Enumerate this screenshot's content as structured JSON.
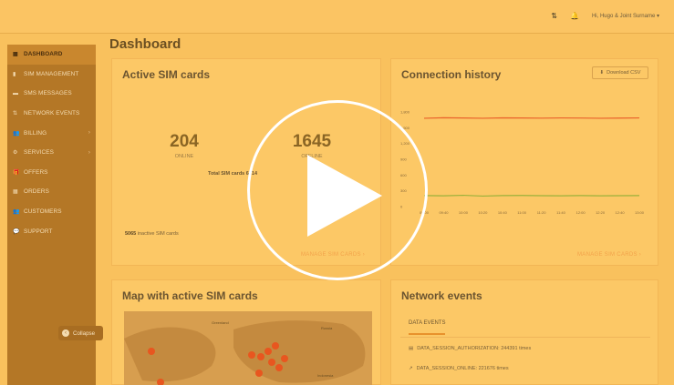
{
  "topbar": {
    "user_label": "Hi, Hugo & Joint Surname"
  },
  "sidebar": {
    "items": [
      {
        "label": "Dashboard",
        "icon": "grid-icon",
        "active": true
      },
      {
        "label": "SIM Management",
        "icon": "sim-icon"
      },
      {
        "label": "SMS Messages",
        "icon": "message-icon"
      },
      {
        "label": "Network Events",
        "icon": "signal-icon"
      },
      {
        "label": "Billing",
        "icon": "people-icon",
        "has_submenu": true
      },
      {
        "label": "Services",
        "icon": "gear-icon",
        "has_submenu": true
      },
      {
        "label": "Offers",
        "icon": "gift-icon"
      },
      {
        "label": "Orders",
        "icon": "box-icon"
      },
      {
        "label": "Customers",
        "icon": "people-icon"
      },
      {
        "label": "Support",
        "icon": "chat-icon"
      }
    ],
    "collapse_label": "Collapse"
  },
  "page": {
    "title": "Dashboard"
  },
  "active_sims": {
    "title": "Active SIM cards",
    "online_value": "204",
    "online_label": "ONLINE",
    "offline_value": "1645",
    "offline_label": "OFFLINE",
    "total_text": "Total SIM cards 6914",
    "inactive_count": "5065",
    "inactive_text": "inactive SIM cards",
    "manage_link": "MANAGE SIM CARDS"
  },
  "connection_history": {
    "title": "Connection history",
    "download_label": "Download CSV",
    "manage_link": "MANAGE SIM CARDS",
    "chart_data": {
      "type": "line",
      "y_ticks": [
        "1,800",
        "1,500",
        "1,200",
        "900",
        "600",
        "300",
        "0"
      ],
      "x_ticks": [
        "09:00",
        "09:40",
        "10:00",
        "10:20",
        "10:40",
        "11:00",
        "11:20",
        "11:40",
        "12:00",
        "12:20",
        "12:40",
        "13:00"
      ],
      "ylim": [
        0,
        1800
      ],
      "series": [
        {
          "color": "#e9612a",
          "values": [
            1680,
            1690,
            1685,
            1680,
            1688,
            1685,
            1682,
            1686,
            1684,
            1680,
            1683,
            1686
          ]
        },
        {
          "color": "#9bb13a",
          "values": [
            210,
            205,
            215,
            200,
            210,
            212,
            208,
            205,
            210,
            206,
            208,
            210
          ]
        }
      ]
    }
  },
  "map_card": {
    "title": "Map with active SIM cards",
    "labels": [
      "Greenland",
      "Russia",
      "Indonesia"
    ]
  },
  "network_events": {
    "title": "Network events",
    "tab_label": "DATA EVENTS",
    "events": [
      {
        "icon": "db-icon",
        "text": "DATA_SESSION_AUTHORIZATION: 244391 times"
      },
      {
        "icon": "arrow-icon",
        "text": "DATA_SESSION_ONLINE: 221676 times"
      }
    ]
  },
  "colors": {
    "overlay": "#f9c15d",
    "sidebar": "#b47726",
    "accent": "#e8922c"
  }
}
